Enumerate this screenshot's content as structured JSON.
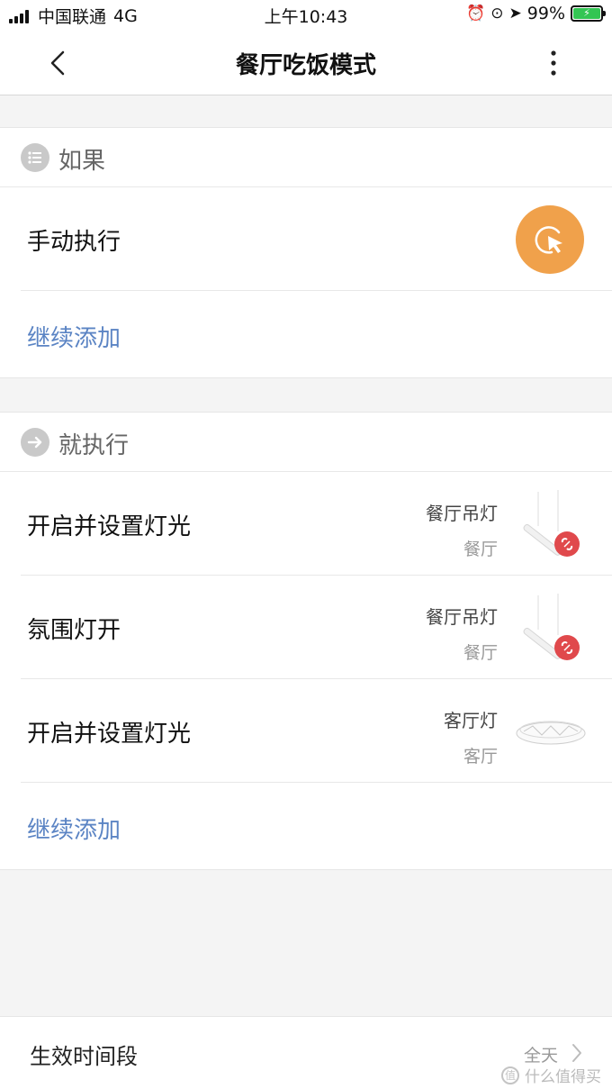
{
  "status_bar": {
    "carrier": "中国联通",
    "network": "4G",
    "time": "上午10:43",
    "battery": "99%"
  },
  "nav": {
    "title": "餐厅吃饭模式"
  },
  "if_section": {
    "label": "如果",
    "condition": "手动执行",
    "add_label": "继续添加",
    "icon_color": "#f0a14b"
  },
  "then_section": {
    "label": "就执行",
    "actions": [
      {
        "title": "开启并设置灯光",
        "device": "餐厅吊灯",
        "room": "餐厅"
      },
      {
        "title": "氛围灯开",
        "device": "餐厅吊灯",
        "room": "餐厅"
      },
      {
        "title": "开启并设置灯光",
        "device": "客厅灯",
        "room": "客厅"
      }
    ],
    "add_label": "继续添加"
  },
  "footer": {
    "title": "生效时间段",
    "value": "全天",
    "watermark": "什么值得买"
  },
  "colors": {
    "accent_link": "#5b84c4",
    "warning_badge": "#e0494c",
    "battery": "#33c553"
  }
}
